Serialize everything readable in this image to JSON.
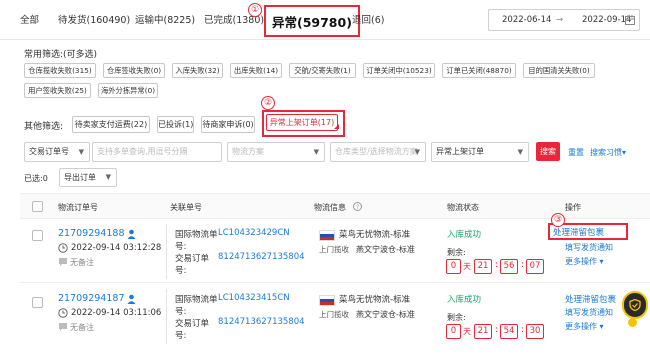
{
  "tabs": {
    "all": "全部",
    "pending": "待发货(160490)",
    "shipping": "运输中(8225)",
    "done": "已完成(1380)",
    "abnormal": "异常(59780)",
    "returned": "退回(6)"
  },
  "markers": {
    "m1": "①",
    "m2": "②",
    "m3": "③"
  },
  "date_range": {
    "start": "2022-06-14",
    "sep": "→",
    "end": "2022-09-14"
  },
  "common_filters": {
    "title": "常用筛选:(可多选)",
    "row1": [
      "仓库揽收失败(315)",
      "仓库签收失败(0)",
      "入库失败(32)",
      "出库失败(14)",
      "交航/交寄失败(1)",
      "订单关闭中(10523)",
      "订单已关闭(48870)",
      "目的国清关失败(0)"
    ],
    "row2": [
      "用户签收失败(25)",
      "海外分拣异常(0)"
    ]
  },
  "other_filters": {
    "title": "其他筛选:",
    "items": [
      "待卖家支付运费(22)",
      "已投诉(1)",
      "待商家申诉(0)",
      "异常上架订单(17)"
    ]
  },
  "search": {
    "field_select": "交易订单号",
    "placeholder": "支持多单查询,用逗号分隔",
    "logistics_plan": "物流方案",
    "warehouse": "仓库类型/选择物流方案",
    "status_select": "异常上架订单",
    "search_btn": "搜索",
    "reset": "重置",
    "habit": "搜索习惯▾"
  },
  "toolbar": {
    "selected": "已选:0",
    "export": "导出订单"
  },
  "table": {
    "headers": [
      "物流订单号",
      "关联单号",
      "物流信息",
      "物流状态",
      "操作"
    ],
    "rows": [
      {
        "order_no": "21709294188",
        "time": "2022-09-14 03:12:28",
        "note": "无备注",
        "ref_label1": "国际物流单",
        "ref_value1": "LC104323429CN",
        "ref_label_suffix": "号:",
        "ref_label2": "交易订单",
        "ref_value2": "8124713627135804",
        "carrier": "菜鸟无忧物流-标准",
        "pickup": "上门揽收",
        "warehouse": "燕文宁波仓-标准",
        "status": "入库成功",
        "remaining": "剩余:",
        "timer": [
          "0",
          "21",
          "56",
          "07"
        ],
        "timer_units": [
          "天"
        ],
        "actions": [
          "处理滞留包裹",
          "填写发货通知",
          "更多操作 ▾"
        ]
      },
      {
        "order_no": "21709294187",
        "time": "2022-09-14 03:11:06",
        "note": "无备注",
        "ref_label1": "国际物流单",
        "ref_value1": "LC104323415CN",
        "ref_label_suffix": "号:",
        "ref_label2": "交易订单",
        "ref_value2": "8124713627135804",
        "carrier": "菜鸟无忧物流-标准",
        "pickup": "上门揽收",
        "warehouse": "燕文宁波仓-标准",
        "status": "入库成功",
        "remaining": "剩余:",
        "timer": [
          "0",
          "21",
          "54",
          "30"
        ],
        "timer_units": [
          "天"
        ],
        "actions": [
          "处理滞留包裹",
          "填写发货通知",
          "更多操作 ▾"
        ]
      }
    ]
  },
  "colors": {
    "accent_red": "#e8283a",
    "link_blue": "#1a7ad8"
  }
}
